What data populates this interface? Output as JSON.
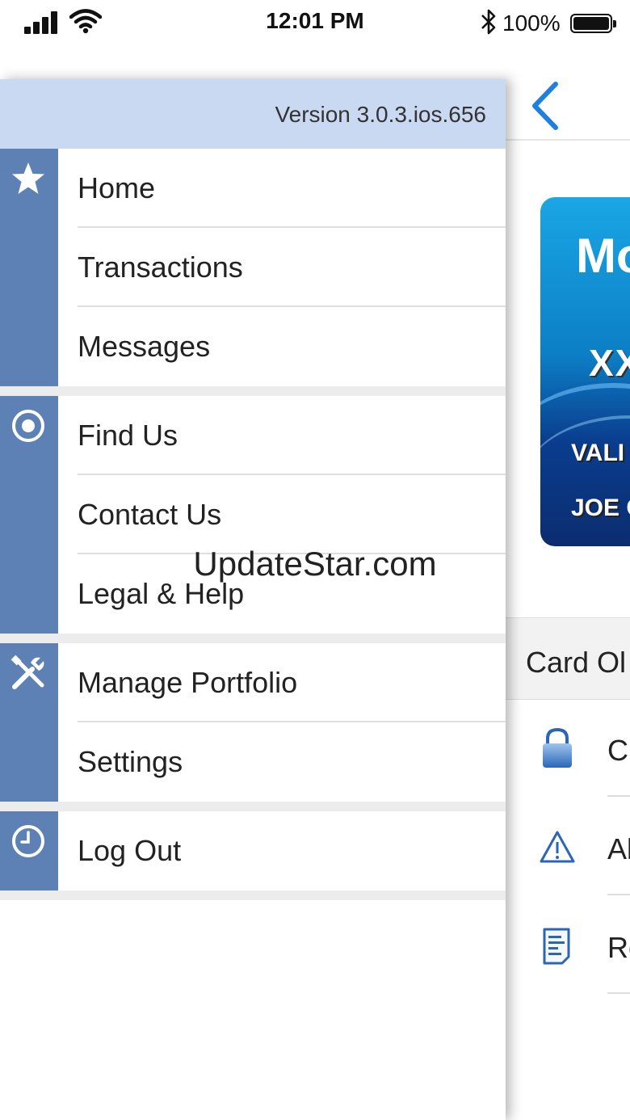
{
  "status_bar": {
    "time": "12:01 PM",
    "battery": "100%",
    "icons": [
      "cellular-signal-icon",
      "wifi-icon",
      "bluetooth-icon",
      "battery-icon"
    ]
  },
  "drawer": {
    "version": "Version 3.0.3.ios.656",
    "accent_color": "#5d80b5",
    "header_color": "#c8d9f1",
    "groups": [
      {
        "icon": "star-icon",
        "items": [
          "Home",
          "Transactions",
          "Messages"
        ]
      },
      {
        "icon": "target-icon",
        "items": [
          "Find Us",
          "Contact Us",
          "Legal & Help"
        ]
      },
      {
        "icon": "tools-icon",
        "items": [
          "Manage Portfolio",
          "Settings"
        ]
      },
      {
        "icon": "clock-icon",
        "items": [
          "Log Out"
        ]
      }
    ]
  },
  "background_screen": {
    "back_icon": "chevron-left-icon",
    "card": {
      "brand_partial": "Mo",
      "number_partial": "XX",
      "valid_partial": "VALI",
      "name_partial": "JOE C"
    },
    "section_title_partial": "Card Ol",
    "options": [
      {
        "icon": "lock-icon",
        "label_partial": "C"
      },
      {
        "icon": "warning-icon",
        "label_partial": "Al"
      },
      {
        "icon": "document-icon",
        "label_partial": "Re"
      }
    ]
  },
  "watermark": "UpdateStar.com"
}
